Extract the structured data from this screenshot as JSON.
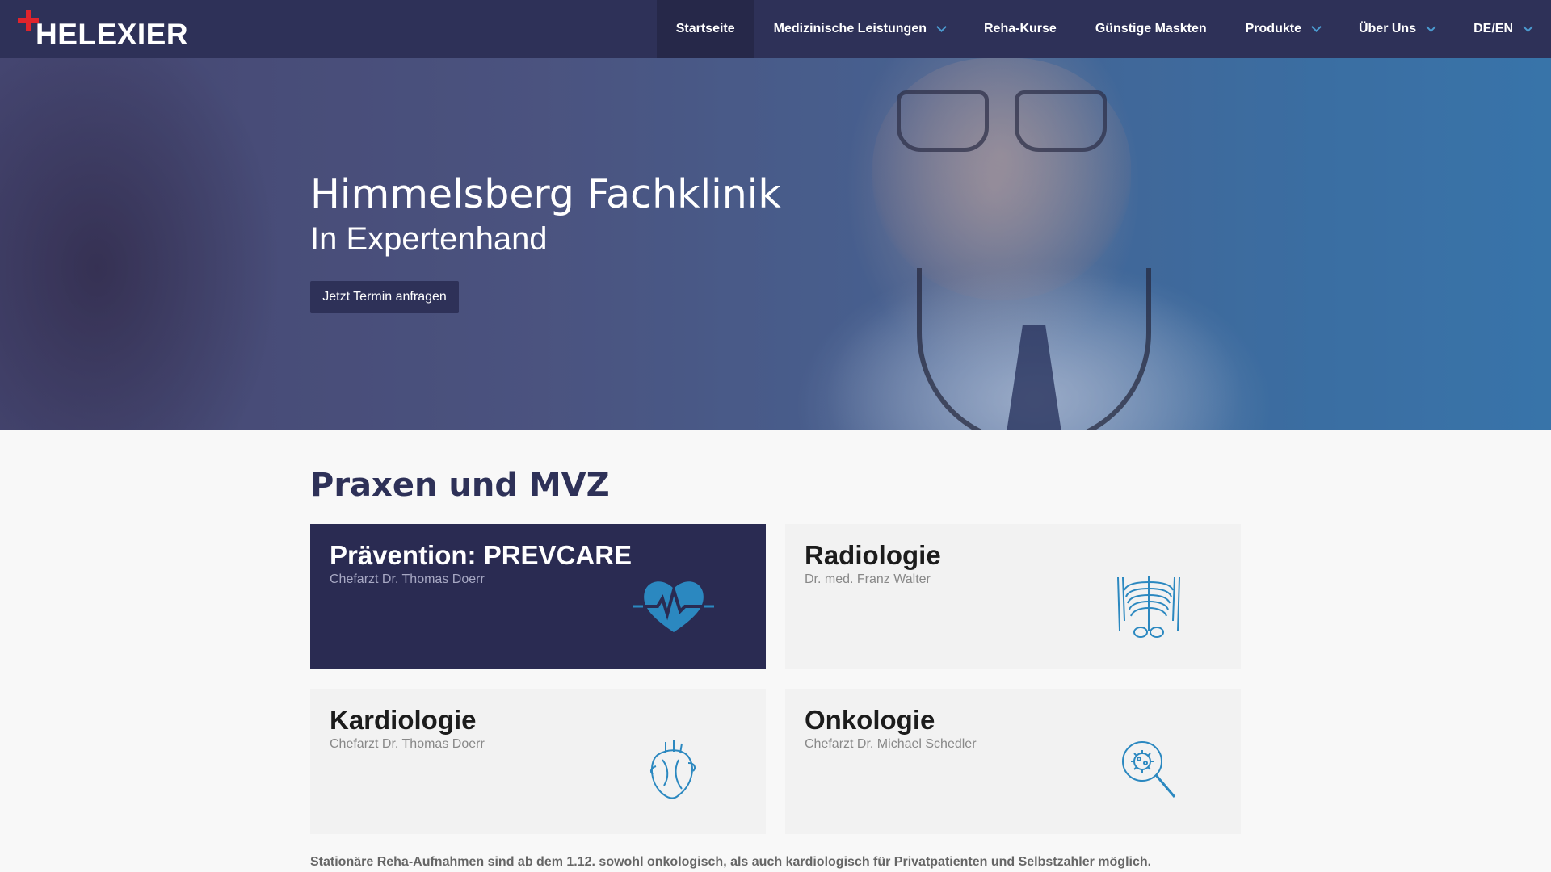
{
  "brand": {
    "name": "HELEXIER",
    "cross_color": "#e0242c"
  },
  "nav": {
    "items": [
      {
        "label": "Startseite",
        "active": true,
        "dropdown": false
      },
      {
        "label": "Medizinische Leistungen",
        "active": false,
        "dropdown": true
      },
      {
        "label": "Reha-Kurse",
        "active": false,
        "dropdown": false
      },
      {
        "label": "Günstige Maskten",
        "active": false,
        "dropdown": false
      },
      {
        "label": "Produkte",
        "active": false,
        "dropdown": true
      },
      {
        "label": "Über Uns",
        "active": false,
        "dropdown": true
      },
      {
        "label": "DE/EN",
        "active": false,
        "dropdown": true
      }
    ],
    "background": "#2e3158",
    "chevron_color": "#4b9bd1"
  },
  "hero": {
    "title": "Himmelsberg Fachklinik",
    "subtitle": "In Expertenhand",
    "cta_label": "Jetzt Termin anfragen"
  },
  "section": {
    "title": "Praxen und MVZ"
  },
  "cards": [
    {
      "title": "Prävention: PREVCARE",
      "subtitle": "Chefarzt Dr. Thomas Doerr",
      "icon": "heart-pulse-icon",
      "highlight": true
    },
    {
      "title": "Radiologie",
      "subtitle": "Dr. med. Franz Walter",
      "icon": "ribcage-xray-icon",
      "highlight": false
    },
    {
      "title": "Kardiologie",
      "subtitle": "Chefarzt Dr. Thomas Doerr",
      "icon": "anatomical-heart-icon",
      "highlight": false
    },
    {
      "title": "Onkologie",
      "subtitle": "Chefarzt Dr. Michael Schedler",
      "icon": "magnifier-cell-icon",
      "highlight": false
    }
  ],
  "note": "Stationäre Reha-Aufnahmen sind ab dem 1.12. sowohl onkologisch, als auch kardiologisch für Privatpatienten und Selbstzahler möglich.",
  "colors": {
    "primary": "#2e3158",
    "icon_blue": "#2b88c0",
    "dark_card": "#2a2b52"
  }
}
